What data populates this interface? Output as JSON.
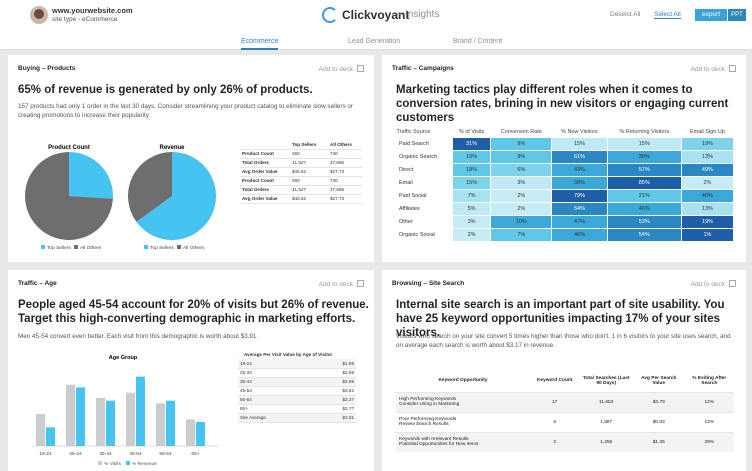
{
  "header": {
    "site_url": "www.yourwebsite.com",
    "site_type": "site type - eCommerce",
    "app_name": "Clickvoyant",
    "separator": "–",
    "section": "Insights",
    "deselect_all": "Deselct All",
    "select_all": "Select All",
    "export": "export",
    "ppt": "PPT"
  },
  "tabs": [
    {
      "label": "Ecommerce",
      "active": true
    },
    {
      "label": "Lead Generation",
      "active": false
    },
    {
      "label": "Brand / Content",
      "active": false
    }
  ],
  "add_to_deck": "Add to deck",
  "panels": {
    "buying": {
      "title": "Buying – Products",
      "headline": "65% of revenue is generated by only 26% of products.",
      "subtext": "157 products had only 1 order in the last 30 days. Consider streamlining your product catalog to eliminate slow sellers or creating promotions to increase their popularity.",
      "pie1_title": "Product Count",
      "pie2_title": "Revenue",
      "legend_top": "Top Sellers",
      "legend_all": "All Others",
      "table_headers": [
        "",
        "Top Sellers",
        "All Others"
      ],
      "table_rows": [
        [
          "Product Count",
          "260",
          "740"
        ],
        [
          "Total Orders",
          "41,827",
          "37,865"
        ],
        [
          "Avg Order Value",
          "$46.62",
          "$27.73"
        ],
        [
          "Product Count",
          "260",
          "740"
        ],
        [
          "Total Orders",
          "41,827",
          "37,865"
        ],
        [
          "Avg Order Value",
          "$46.62",
          "$27.73"
        ]
      ]
    },
    "campaigns": {
      "title": "Traffic – Campaigns",
      "headline": "Marketing tactics play different roles when it comes to conversion rates, brining in new visitors or engaging current customers",
      "columns": [
        "Traffic Source",
        "% of Visits",
        "Conversion Rate",
        "% New Visitors",
        "% Returning Visitors",
        "Email Sign Up"
      ],
      "rows": [
        {
          "source": "Paid Search",
          "values": [
            "31%",
            "9%",
            "15%",
            "15%",
            "19%"
          ],
          "colors": [
            "#1e5fa8",
            "#5fc8e8",
            "#bfeaf5",
            "#bfeaf5",
            "#7dd3ec"
          ]
        },
        {
          "source": "Organic Search",
          "values": [
            "19%",
            "9%",
            "61%",
            "39%",
            "13%"
          ],
          "colors": [
            "#5fc8e8",
            "#5fc8e8",
            "#2b86c4",
            "#3aa8d8",
            "#a8e2f2"
          ]
        },
        {
          "source": "Direct",
          "values": [
            "18%",
            "6%",
            "43%",
            "57%",
            "49%"
          ],
          "colors": [
            "#5fc8e8",
            "#7dd3ec",
            "#3aa8d8",
            "#2b86c4",
            "#2b86c4"
          ]
        },
        {
          "source": "Email",
          "values": [
            "15%",
            "3%",
            "38%",
            "85%",
            "2%"
          ],
          "colors": [
            "#7dd3ec",
            "#bfeaf5",
            "#3aa8d8",
            "#1e5fa8",
            "#c8ecf6"
          ]
        },
        {
          "source": "Paid Social",
          "values": [
            "7%",
            "2%",
            "79%",
            "21%",
            "40%"
          ],
          "colors": [
            "#a8e2f2",
            "#c8ecf6",
            "#1e5fa8",
            "#5fc8e8",
            "#3aa8d8"
          ]
        },
        {
          "source": "Affiliates",
          "values": [
            "5%",
            "2%",
            "54%",
            "46%",
            "13%"
          ],
          "colors": [
            "#bfeaf5",
            "#c8ecf6",
            "#2b86c4",
            "#3aa8d8",
            "#a8e2f2"
          ]
        },
        {
          "source": "Other",
          "values": [
            "3%",
            "10%",
            "47%",
            "53%",
            "19%"
          ],
          "colors": [
            "#c8ecf6",
            "#3aa8d8",
            "#3aa8d8",
            "#2b86c4",
            "#1e5fa8"
          ]
        },
        {
          "source": "Organic Social",
          "values": [
            "2%",
            "7%",
            "46%",
            "54%",
            "1%"
          ],
          "colors": [
            "#c8ecf6",
            "#5fc8e8",
            "#3aa8d8",
            "#2b86c4",
            "#1e5fa8"
          ]
        }
      ]
    },
    "age": {
      "title": "Traffic – Age",
      "headline": "People aged 45-54 account for 20% of visits but 26% of revenue. Target this high-converting demographic in marketing efforts.",
      "subtext": "Men 45-54 convert even better. Each visit from this demographic is worth about $3.91.",
      "chart_title": "Age Group",
      "legend_visits": "% Visits",
      "legend_revenue": "% Revenue",
      "table_title": "Average Per Visit Value by Age of Visitor",
      "table_rows": [
        [
          "18-24",
          "$1.89"
        ],
        [
          "25-34",
          "$2.98"
        ],
        [
          "35-44",
          "$2.95"
        ],
        [
          "45-54",
          "$3.82"
        ],
        [
          "55-64",
          "$3.37"
        ],
        [
          "65+",
          "$2.77"
        ],
        [
          "Site Average",
          "$3.01"
        ]
      ]
    },
    "search": {
      "title": "Browsing – Site Search",
      "headline": "Internal site search is an important part of site usability. You have 25 keyword opportunities impacting 17% of your sites visitors.",
      "subtext": "Visitors who search on your site convert 5 times higher than those who don't. 1 in 6 visitors to your site uses search, and on average each search is worth about $3.17 in revenue.",
      "columns": [
        "Keyword Opportunity",
        "Keyword Count",
        "Total Searches (Last 90 Days)",
        "Avg Per Search Value",
        "% Exiting After Search"
      ],
      "rows": [
        {
          "label1": "High Performing Keywords",
          "label2": "Consider Using in Marketing",
          "values": [
            "17",
            "11,653",
            "$3.79",
            "12%"
          ]
        },
        {
          "label1": "Poor Performing Keywords",
          "label2": "Review Search Results",
          "values": [
            "6",
            "1,887",
            "$0.83",
            "12%"
          ]
        },
        {
          "label1": "Keywords with Irrelevant Results",
          "label2": "Potential Opportunities for New Items",
          "values": [
            "2",
            "1,255",
            "$1.35",
            "29%"
          ]
        }
      ]
    }
  },
  "chart_data": [
    {
      "type": "pie",
      "title": "Product Count",
      "labels": [
        "Top Sellers",
        "All Others"
      ],
      "values": [
        26,
        74
      ],
      "colors": [
        "#45c4f2",
        "#6e6e6e"
      ]
    },
    {
      "type": "pie",
      "title": "Revenue",
      "labels": [
        "Top Sellers",
        "All Others"
      ],
      "values": [
        65,
        35
      ],
      "colors": [
        "#45c4f2",
        "#6e6e6e"
      ]
    },
    {
      "type": "bar",
      "title": "Age Group",
      "categories": [
        "18-24",
        "25-34",
        "35-44",
        "45-54",
        "55-64",
        "65+"
      ],
      "series": [
        {
          "name": "% Visits",
          "values": [
            12,
            23,
            18,
            20,
            16,
            10
          ],
          "color": "#c9cdd0"
        },
        {
          "name": "% Revenue",
          "values": [
            7,
            22,
            17,
            26,
            17,
            9
          ],
          "color": "#45c4f2"
        }
      ],
      "ylim": [
        0,
        30
      ]
    }
  ]
}
